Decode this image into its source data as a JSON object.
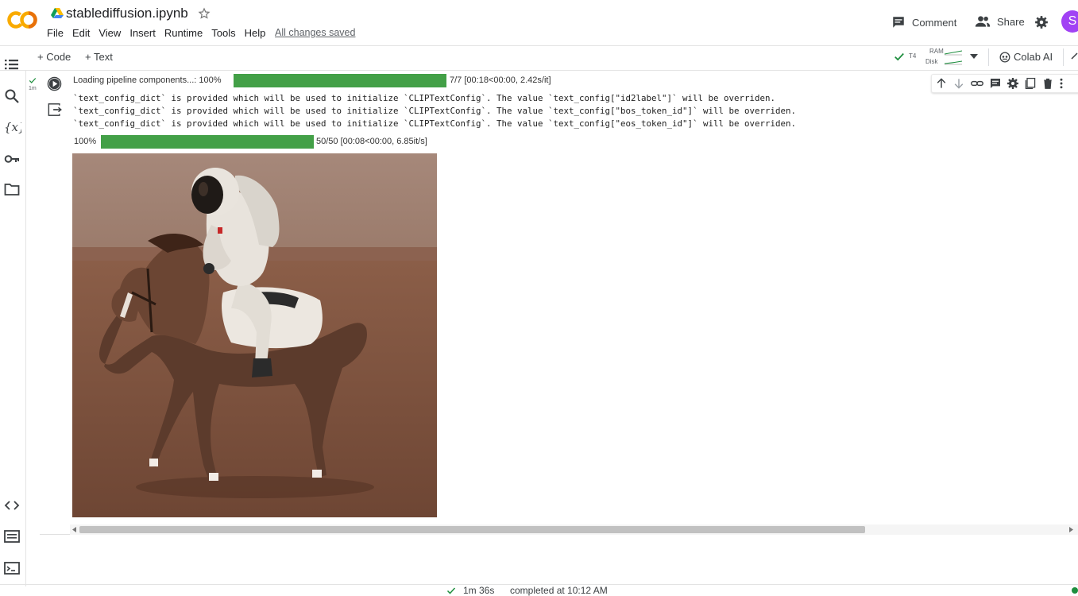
{
  "header": {
    "logo_text": "CO",
    "title": "stablediffusion.ipynb",
    "menu": [
      "File",
      "Edit",
      "View",
      "Insert",
      "Runtime",
      "Tools",
      "Help"
    ],
    "save_status": "All changes saved",
    "comment_label": "Comment",
    "share_label": "Share",
    "avatar_letter": "S"
  },
  "toolbar": {
    "add_code_label": "+ Code",
    "add_text_label": "+ Text",
    "runtime_type": "T4",
    "ram_label": "RAM",
    "disk_label": "Disk",
    "colab_ai_label": "Colab AI"
  },
  "sidebar": {
    "icons": [
      "table-of-contents-icon",
      "search-icon",
      "variables-icon",
      "secrets-key-icon",
      "files-folder-icon",
      "code-snippets-icon",
      "command-palette-icon",
      "terminal-icon"
    ]
  },
  "cell": {
    "exec_time": "1m",
    "progress1": {
      "label": "Loading pipeline components...: 100%",
      "fraction": 1.0,
      "stats": "7/7 [00:18<00:00,  2.42s/it]"
    },
    "log_lines": [
      "`text_config_dict` is provided which will be used to initialize `CLIPTextConfig`. The value `text_config[\"id2label\"]` will be overriden.",
      "`text_config_dict` is provided which will be used to initialize `CLIPTextConfig`. The value `text_config[\"bos_token_id\"]` will be overriden.",
      "`text_config_dict` is provided which will be used to initialize `CLIPTextConfig`. The value `text_config[\"eos_token_id\"]` will be overriden."
    ],
    "progress2": {
      "label": "100%",
      "fraction": 1.0,
      "stats": "50/50 [00:08<00:00,  6.85it/s]"
    },
    "toolbar_icons": [
      "move-up-icon",
      "move-down-icon",
      "link-icon",
      "comment-icon",
      "settings-icon",
      "mirror-cell-icon",
      "delete-icon",
      "more-icon"
    ]
  },
  "statusbar": {
    "elapsed": "1m 36s",
    "completed": "completed at 10:12 AM"
  },
  "colors": {
    "progress_green": "#43a047",
    "logo_orange": "#f9ab00",
    "accent_purple": "#a142f4"
  }
}
